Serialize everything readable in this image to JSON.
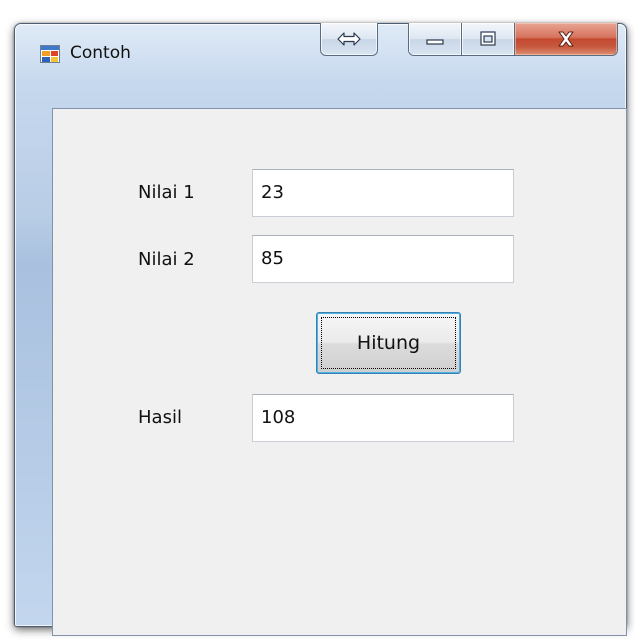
{
  "window": {
    "title": "Contoh",
    "caption_close_glyph": "x"
  },
  "form": {
    "nilai1_label": "Nilai 1",
    "nilai1_value": "23",
    "nilai2_label": "Nilai 2",
    "nilai2_value": "85",
    "hitung_label": "Hitung",
    "hasil_label": "Hasil",
    "hasil_value": "108"
  },
  "icons": {
    "app": "form-app-icon",
    "extra": "resize-arrows-icon",
    "minimize": "minimize-icon",
    "maximize": "maximize-icon",
    "close": "close-icon"
  },
  "colors": {
    "client_bg": "#f0f0f0",
    "close_button": "#c4492f",
    "button_focus_border": "#3c7fb1"
  }
}
